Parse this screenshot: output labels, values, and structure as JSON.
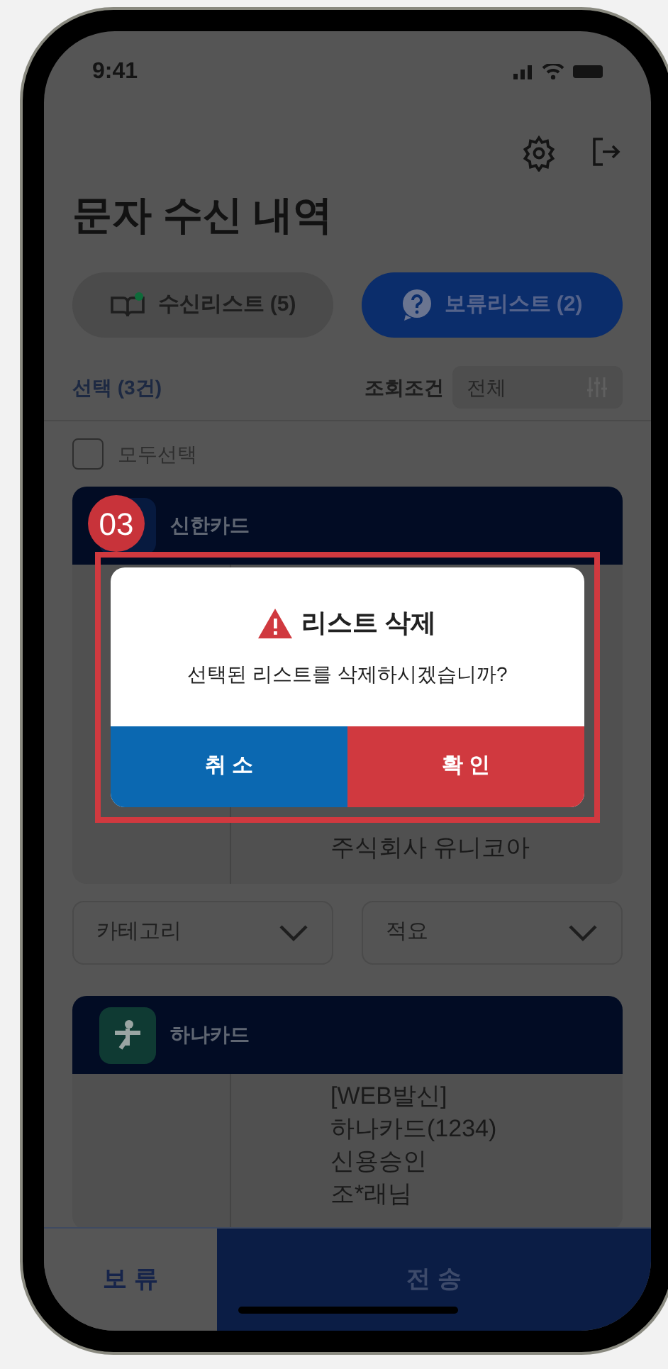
{
  "status_bar": {
    "time": "9:41"
  },
  "title": "문자 수신 내역",
  "tabs": [
    {
      "label": "수신리스트 (5)",
      "selected": false,
      "kind": "book"
    },
    {
      "label": "보류리스트 (2)",
      "selected": true,
      "kind": "question"
    }
  ],
  "selection": {
    "count": "선택 (3건)",
    "filter_label": "조회조건",
    "filter_value": "전체"
  },
  "select_all": {
    "label": "모두선택",
    "checked": false
  },
  "cards": [
    {
      "issuer": "신한카드",
      "kind": "shinhan",
      "message_lines": [
        "주식회사 유니코아"
      ]
    },
    {
      "issuer": "하나카드",
      "kind": "hana",
      "message_lines": [
        "[WEB발신]",
        "하나카드(1234)",
        "신용승인",
        "조*래님"
      ]
    }
  ],
  "filters": [
    {
      "placeholder": "카테고리"
    },
    {
      "placeholder": "적요"
    }
  ],
  "dialog": {
    "step_badge": "03",
    "title": "리스트 삭제",
    "message": "선택된 리스트를 삭제하시겠습니까?",
    "buttons": [
      {
        "label": "취 소",
        "kind": "cancel"
      },
      {
        "label": "확 인",
        "kind": "confirm"
      }
    ]
  },
  "bottom_bar": [
    {
      "label": "보 류",
      "kind": "secondary"
    },
    {
      "label": "전 송",
      "kind": "primary"
    }
  ]
}
